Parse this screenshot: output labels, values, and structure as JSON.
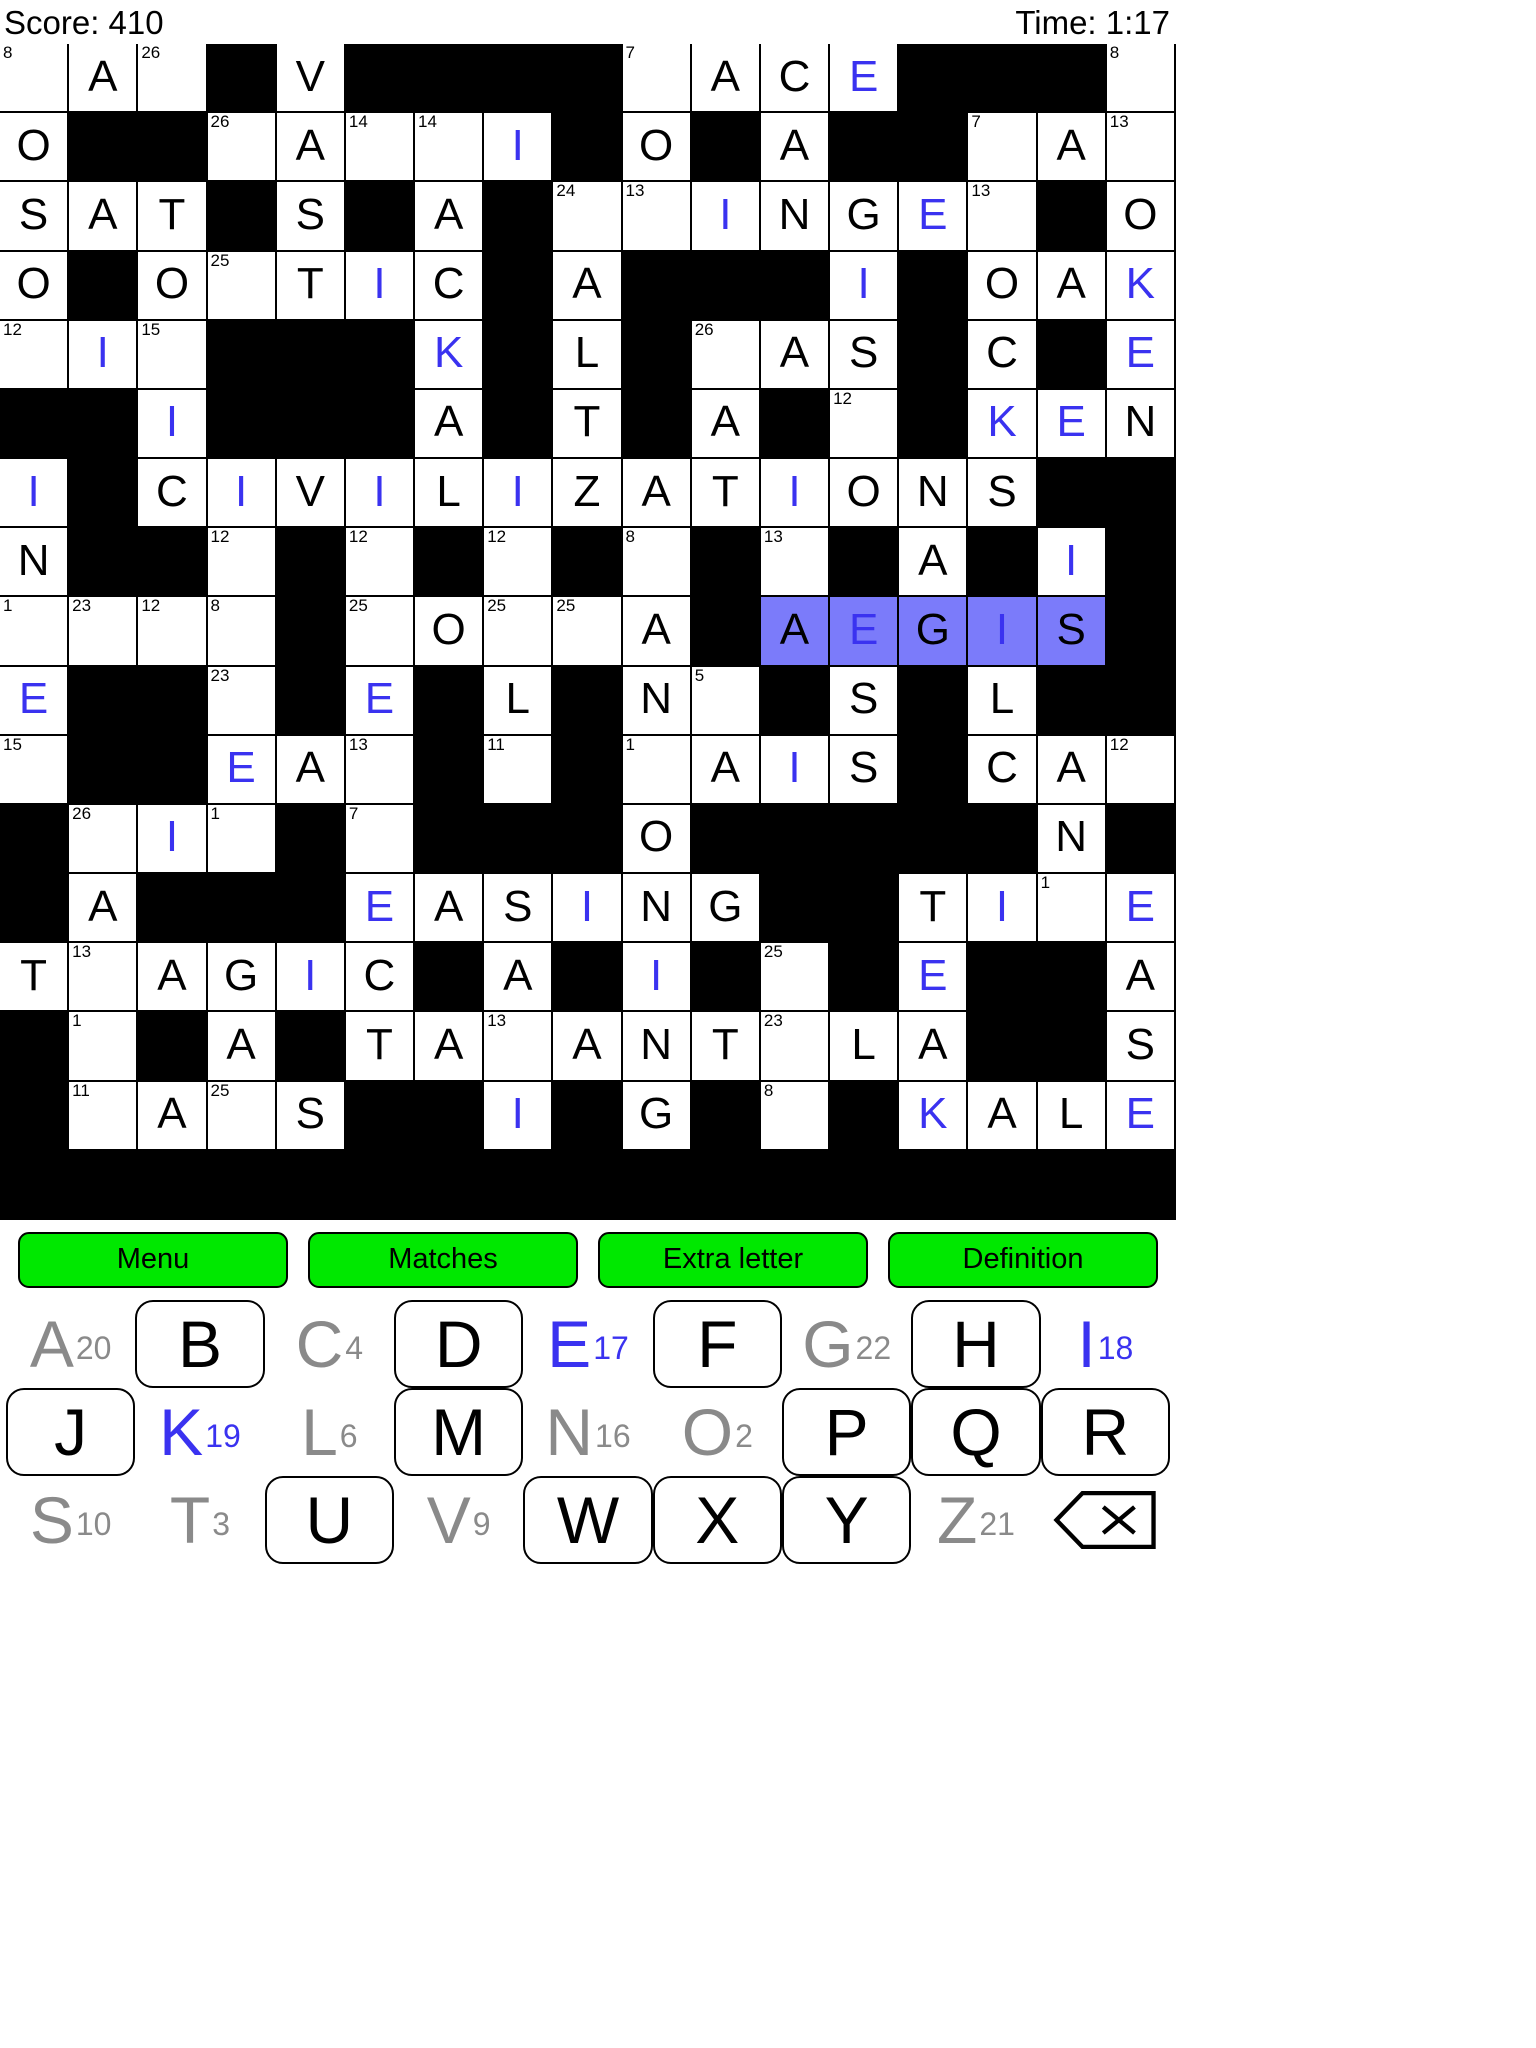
{
  "status": {
    "score_label": "Score: 410",
    "time_label": "Time: 1:17"
  },
  "buttons": [
    {
      "id": "menu",
      "label": "Menu"
    },
    {
      "id": "matches",
      "label": "Matches"
    },
    {
      "id": "extraletter",
      "label": "Extra letter"
    },
    {
      "id": "definition",
      "label": "Definition"
    }
  ],
  "colors": {
    "selection": "#7b7bfa",
    "entered_letter": "#3a32f0",
    "button_green": "#00e800",
    "used_key": "#8a8a8a"
  },
  "keyboard": {
    "rows": [
      [
        {
          "letter": "A",
          "number": "20",
          "state": "used"
        },
        {
          "letter": "B",
          "number": "",
          "state": "avail"
        },
        {
          "letter": "C",
          "number": "4",
          "state": "used"
        },
        {
          "letter": "D",
          "number": "",
          "state": "avail"
        },
        {
          "letter": "E",
          "number": "17",
          "state": "cur"
        },
        {
          "letter": "F",
          "number": "",
          "state": "avail"
        },
        {
          "letter": "G",
          "number": "22",
          "state": "used"
        },
        {
          "letter": "H",
          "number": "",
          "state": "avail"
        },
        {
          "letter": "I",
          "number": "18",
          "state": "cur"
        }
      ],
      [
        {
          "letter": "J",
          "number": "",
          "state": "avail"
        },
        {
          "letter": "K",
          "number": "19",
          "state": "cur"
        },
        {
          "letter": "L",
          "number": "6",
          "state": "used"
        },
        {
          "letter": "M",
          "number": "",
          "state": "avail"
        },
        {
          "letter": "N",
          "number": "16",
          "state": "used"
        },
        {
          "letter": "O",
          "number": "2",
          "state": "used"
        },
        {
          "letter": "P",
          "number": "",
          "state": "avail"
        },
        {
          "letter": "Q",
          "number": "",
          "state": "avail"
        },
        {
          "letter": "R",
          "number": "",
          "state": "avail"
        }
      ],
      [
        {
          "letter": "S",
          "number": "10",
          "state": "used"
        },
        {
          "letter": "T",
          "number": "3",
          "state": "used"
        },
        {
          "letter": "U",
          "number": "",
          "state": "avail"
        },
        {
          "letter": "V",
          "number": "9",
          "state": "used"
        },
        {
          "letter": "W",
          "number": "",
          "state": "avail"
        },
        {
          "letter": "X",
          "number": "",
          "state": "avail"
        },
        {
          "letter": "Y",
          "number": "",
          "state": "avail"
        },
        {
          "letter": "Z",
          "number": "21",
          "state": "used"
        },
        {
          "letter": "⌫",
          "number": "",
          "state": "backspace"
        }
      ]
    ]
  },
  "grid": {
    "cols": 17,
    "rows": 17,
    "cells": [
      [
        {
          "o": 1,
          "n": "8"
        },
        {
          "o": 1,
          "l": "A"
        },
        {
          "o": 1,
          "n": "26"
        },
        {
          "o": 0
        },
        {
          "o": 1,
          "l": "V"
        },
        {
          "o": 0
        },
        {
          "o": 0
        },
        {
          "o": 0
        },
        {
          "o": 0
        },
        {
          "o": 1,
          "n": "7"
        },
        {
          "o": 1,
          "l": "A"
        },
        {
          "o": 1,
          "l": "C"
        },
        {
          "o": 1,
          "l": "E",
          "b": 1
        },
        {
          "o": 0
        },
        {
          "o": 0
        },
        {
          "o": 0
        },
        {
          "o": 1,
          "n": "8"
        }
      ],
      [
        {
          "o": 1,
          "l": "O"
        },
        {
          "o": 0
        },
        {
          "o": 0
        },
        {
          "o": 1,
          "n": "26"
        },
        {
          "o": 1,
          "l": "A"
        },
        {
          "o": 1,
          "n": "14"
        },
        {
          "o": 1,
          "n": "14"
        },
        {
          "o": 1,
          "l": "I",
          "b": 1
        },
        {
          "o": 0
        },
        {
          "o": 1,
          "l": "O"
        },
        {
          "o": 0
        },
        {
          "o": 1,
          "l": "A"
        },
        {
          "o": 0
        },
        {
          "o": 0
        },
        {
          "o": 1,
          "n": "7"
        },
        {
          "o": 1,
          "l": "A"
        },
        {
          "o": 1,
          "n": "13"
        }
      ],
      [
        {
          "o": 1,
          "l": "S"
        },
        {
          "o": 1,
          "l": "A"
        },
        {
          "o": 1,
          "l": "T"
        },
        {
          "o": 0
        },
        {
          "o": 1,
          "l": "S"
        },
        {
          "o": 0
        },
        {
          "o": 1,
          "l": "A"
        },
        {
          "o": 0
        },
        {
          "o": 1,
          "n": "24"
        },
        {
          "o": 1,
          "n": "13"
        },
        {
          "o": 1,
          "l": "I",
          "b": 1
        },
        {
          "o": 1,
          "l": "N"
        },
        {
          "o": 1,
          "l": "G"
        },
        {
          "o": 1,
          "l": "E",
          "b": 1
        },
        {
          "o": 1,
          "n": "13"
        },
        {
          "o": 0
        },
        {
          "o": 1,
          "l": "O"
        }
      ],
      [
        {
          "o": 1,
          "l": "O"
        },
        {
          "o": 0
        },
        {
          "o": 1,
          "l": "O"
        },
        {
          "o": 1,
          "n": "25"
        },
        {
          "o": 1,
          "l": "T"
        },
        {
          "o": 1,
          "l": "I",
          "b": 1
        },
        {
          "o": 1,
          "l": "C"
        },
        {
          "o": 0
        },
        {
          "o": 1,
          "l": "A"
        },
        {
          "o": 0
        },
        {
          "o": 0
        },
        {
          "o": 0
        },
        {
          "o": 1,
          "l": "I",
          "b": 1
        },
        {
          "o": 0
        },
        {
          "o": 1,
          "l": "O"
        },
        {
          "o": 1,
          "l": "A"
        },
        {
          "o": 1,
          "l": "K",
          "b": 1
        }
      ],
      [
        {
          "o": 1,
          "n": "12"
        },
        {
          "o": 1,
          "l": "I",
          "b": 1
        },
        {
          "o": 1,
          "n": "15"
        },
        {
          "o": 0
        },
        {
          "o": 0
        },
        {
          "o": 0
        },
        {
          "o": 1,
          "l": "K",
          "b": 1
        },
        {
          "o": 0
        },
        {
          "o": 1,
          "l": "L"
        },
        {
          "o": 0
        },
        {
          "o": 1,
          "n": "26"
        },
        {
          "o": 1,
          "l": "A"
        },
        {
          "o": 1,
          "l": "S"
        },
        {
          "o": 0
        },
        {
          "o": 1,
          "l": "C"
        },
        {
          "o": 0
        },
        {
          "o": 1,
          "l": "E",
          "b": 1
        }
      ],
      [
        {
          "o": 0
        },
        {
          "o": 0
        },
        {
          "o": 1,
          "l": "I",
          "b": 1
        },
        {
          "o": 0
        },
        {
          "o": 0
        },
        {
          "o": 0
        },
        {
          "o": 1,
          "l": "A"
        },
        {
          "o": 0
        },
        {
          "o": 1,
          "l": "T"
        },
        {
          "o": 0
        },
        {
          "o": 1,
          "l": "A"
        },
        {
          "o": 0
        },
        {
          "o": 1,
          "n": "12"
        },
        {
          "o": 0
        },
        {
          "o": 1,
          "l": "K",
          "b": 1
        },
        {
          "o": 1,
          "l": "E",
          "b": 1
        },
        {
          "o": 1,
          "l": "N"
        }
      ],
      [
        {
          "o": 1,
          "l": "I",
          "b": 1
        },
        {
          "o": 0
        },
        {
          "o": 1,
          "l": "C"
        },
        {
          "o": 1,
          "l": "I",
          "b": 1
        },
        {
          "o": 1,
          "l": "V"
        },
        {
          "o": 1,
          "l": "I",
          "b": 1
        },
        {
          "o": 1,
          "l": "L"
        },
        {
          "o": 1,
          "l": "I",
          "b": 1
        },
        {
          "o": 1,
          "l": "Z"
        },
        {
          "o": 1,
          "l": "A"
        },
        {
          "o": 1,
          "l": "T"
        },
        {
          "o": 1,
          "l": "I",
          "b": 1
        },
        {
          "o": 1,
          "l": "O"
        },
        {
          "o": 1,
          "l": "N"
        },
        {
          "o": 1,
          "l": "S"
        },
        {
          "o": 0
        },
        {
          "o": 0
        }
      ],
      [
        {
          "o": 1,
          "l": "N"
        },
        {
          "o": 0
        },
        {
          "o": 0
        },
        {
          "o": 1,
          "n": "12"
        },
        {
          "o": 0
        },
        {
          "o": 1,
          "n": "12"
        },
        {
          "o": 0
        },
        {
          "o": 1,
          "n": "12"
        },
        {
          "o": 0
        },
        {
          "o": 1,
          "n": "8"
        },
        {
          "o": 0
        },
        {
          "o": 1,
          "n": "13"
        },
        {
          "o": 0
        },
        {
          "o": 1,
          "l": "A"
        },
        {
          "o": 0
        },
        {
          "o": 1,
          "l": "I",
          "b": 1
        },
        {
          "o": 0
        }
      ],
      [
        {
          "o": 1,
          "n": "1"
        },
        {
          "o": 1,
          "n": "23"
        },
        {
          "o": 1,
          "n": "12"
        },
        {
          "o": 1,
          "n": "8"
        },
        {
          "o": 0
        },
        {
          "o": 1,
          "n": "25"
        },
        {
          "o": 1,
          "l": "O"
        },
        {
          "o": 1,
          "n": "25"
        },
        {
          "o": 1,
          "n": "25"
        },
        {
          "o": 1,
          "l": "A"
        },
        {
          "o": 0
        },
        {
          "o": 1,
          "l": "A",
          "s": 1
        },
        {
          "o": 1,
          "l": "E",
          "b": 1,
          "s": 1
        },
        {
          "o": 1,
          "l": "G",
          "s": 1
        },
        {
          "o": 1,
          "l": "I",
          "b": 1,
          "s": 1
        },
        {
          "o": 1,
          "l": "S",
          "s": 1
        },
        {
          "o": 0
        }
      ],
      [
        {
          "o": 1,
          "l": "E",
          "b": 1
        },
        {
          "o": 0
        },
        {
          "o": 0
        },
        {
          "o": 1,
          "n": "23"
        },
        {
          "o": 0
        },
        {
          "o": 1,
          "l": "E",
          "b": 1
        },
        {
          "o": 0
        },
        {
          "o": 1,
          "l": "L"
        },
        {
          "o": 0
        },
        {
          "o": 1,
          "l": "N"
        },
        {
          "o": 1,
          "n": "5"
        },
        {
          "o": 0
        },
        {
          "o": 1,
          "l": "S"
        },
        {
          "o": 0
        },
        {
          "o": 1,
          "l": "L"
        },
        {
          "o": 0
        },
        {
          "o": 0
        }
      ],
      [
        {
          "o": 1,
          "n": "15"
        },
        {
          "o": 0
        },
        {
          "o": 0
        },
        {
          "o": 1,
          "l": "E",
          "b": 1
        },
        {
          "o": 1,
          "l": "A"
        },
        {
          "o": 1,
          "n": "13"
        },
        {
          "o": 0
        },
        {
          "o": 1,
          "n": "11"
        },
        {
          "o": 0
        },
        {
          "o": 1,
          "n": "1"
        },
        {
          "o": 1,
          "l": "A"
        },
        {
          "o": 1,
          "l": "I",
          "b": 1
        },
        {
          "o": 1,
          "l": "S"
        },
        {
          "o": 0
        },
        {
          "o": 1,
          "l": "C"
        },
        {
          "o": 1,
          "l": "A"
        },
        {
          "o": 1,
          "n": "12"
        }
      ],
      [
        {
          "o": 0
        },
        {
          "o": 1,
          "n": "26"
        },
        {
          "o": 1,
          "l": "I",
          "b": 1
        },
        {
          "o": 1,
          "n": "1"
        },
        {
          "o": 0
        },
        {
          "o": 1,
          "n": "7"
        },
        {
          "o": 0
        },
        {
          "o": 0
        },
        {
          "o": 0
        },
        {
          "o": 1,
          "l": "O"
        },
        {
          "o": 0
        },
        {
          "o": 0
        },
        {
          "o": 0
        },
        {
          "o": 0
        },
        {
          "o": 0
        },
        {
          "o": 1,
          "l": "N"
        },
        {
          "o": 0
        }
      ],
      [
        {
          "o": 0
        },
        {
          "o": 1,
          "l": "A"
        },
        {
          "o": 0
        },
        {
          "o": 0
        },
        {
          "o": 0
        },
        {
          "o": 1,
          "l": "E",
          "b": 1
        },
        {
          "o": 1,
          "l": "A"
        },
        {
          "o": 1,
          "l": "S"
        },
        {
          "o": 1,
          "l": "I",
          "b": 1
        },
        {
          "o": 1,
          "l": "N"
        },
        {
          "o": 1,
          "l": "G"
        },
        {
          "o": 0
        },
        {
          "o": 0
        },
        {
          "o": 1,
          "l": "T"
        },
        {
          "o": 1,
          "l": "I",
          "b": 1
        },
        {
          "o": 1,
          "n": "1"
        },
        {
          "o": 1,
          "l": "E",
          "b": 1
        }
      ],
      [
        {
          "o": 1,
          "l": "T"
        },
        {
          "o": 1,
          "n": "13"
        },
        {
          "o": 1,
          "l": "A"
        },
        {
          "o": 1,
          "l": "G"
        },
        {
          "o": 1,
          "l": "I",
          "b": 1
        },
        {
          "o": 1,
          "l": "C"
        },
        {
          "o": 0
        },
        {
          "o": 1,
          "l": "A"
        },
        {
          "o": 0
        },
        {
          "o": 1,
          "l": "I",
          "b": 1
        },
        {
          "o": 0
        },
        {
          "o": 1,
          "n": "25"
        },
        {
          "o": 0
        },
        {
          "o": 1,
          "l": "E",
          "b": 1
        },
        {
          "o": 0
        },
        {
          "o": 0
        },
        {
          "o": 1,
          "l": "A"
        }
      ],
      [
        {
          "o": 0
        },
        {
          "o": 1,
          "n": "1"
        },
        {
          "o": 0
        },
        {
          "o": 1,
          "l": "A"
        },
        {
          "o": 0
        },
        {
          "o": 1,
          "l": "T"
        },
        {
          "o": 1,
          "l": "A"
        },
        {
          "o": 1,
          "n": "13"
        },
        {
          "o": 1,
          "l": "A"
        },
        {
          "o": 1,
          "l": "N"
        },
        {
          "o": 1,
          "l": "T"
        },
        {
          "o": 1,
          "n": "23"
        },
        {
          "o": 1,
          "l": "L"
        },
        {
          "o": 1,
          "l": "A"
        },
        {
          "o": 0
        },
        {
          "o": 0
        },
        {
          "o": 1,
          "l": "S"
        }
      ],
      [
        {
          "o": 0
        },
        {
          "o": 1,
          "n": "11"
        },
        {
          "o": 1,
          "l": "A"
        },
        {
          "o": 1,
          "n": "25"
        },
        {
          "o": 1,
          "l": "S"
        },
        {
          "o": 0
        },
        {
          "o": 0
        },
        {
          "o": 1,
          "l": "I",
          "b": 1
        },
        {
          "o": 0
        },
        {
          "o": 1,
          "l": "G"
        },
        {
          "o": 0
        },
        {
          "o": 1,
          "n": "8"
        },
        {
          "o": 0
        },
        {
          "o": 1,
          "l": "K",
          "b": 1
        },
        {
          "o": 1,
          "l": "A"
        },
        {
          "o": 1,
          "l": "L"
        },
        {
          "o": 1,
          "l": "E",
          "b": 1
        }
      ],
      [
        {
          "o": 0
        },
        {
          "o": 0
        },
        {
          "o": 0
        },
        {
          "o": 0
        },
        {
          "o": 0
        },
        {
          "o": 0
        },
        {
          "o": 0
        },
        {
          "o": 0
        },
        {
          "o": 0
        },
        {
          "o": 0
        },
        {
          "o": 0
        },
        {
          "o": 0
        },
        {
          "o": 0
        },
        {
          "o": 0
        },
        {
          "o": 0
        },
        {
          "o": 0
        },
        {
          "o": 0
        }
      ]
    ]
  }
}
